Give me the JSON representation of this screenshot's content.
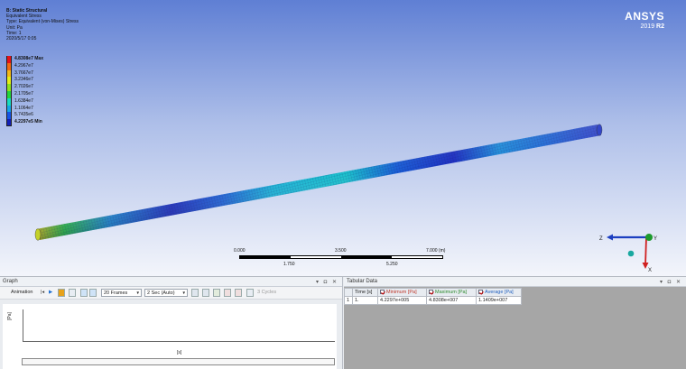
{
  "viewport": {
    "title": "B: Static Structural",
    "result_name": "Equivalent Stress",
    "type_line": "Type: Equivalent (von-Mises) Stress",
    "unit_line": "Unit: Pa",
    "time_line": "Time: 1",
    "date_line": "2020/5/17 0:05"
  },
  "brand": {
    "name": "ANSYS",
    "version": "2019",
    "release": "R2"
  },
  "legend": [
    {
      "label": "4.8308e7 Max",
      "color": "#e8121a",
      "emphasis": true
    },
    {
      "label": "4.2967e7",
      "color": "#f26a12",
      "emphasis": false
    },
    {
      "label": "3.7667e7",
      "color": "#f3b816",
      "emphasis": false
    },
    {
      "label": "3.2346e7",
      "color": "#e6ee16",
      "emphasis": false
    },
    {
      "label": "2.7026e7",
      "color": "#8ee21c",
      "emphasis": false
    },
    {
      "label": "2.1705e7",
      "color": "#22d63c",
      "emphasis": false
    },
    {
      "label": "1.6384e7",
      "color": "#16dcc0",
      "emphasis": false
    },
    {
      "label": "1.1064e7",
      "color": "#16a6e8",
      "emphasis": false
    },
    {
      "label": "5.7435e6",
      "color": "#1654e6",
      "emphasis": false
    },
    {
      "label": "4.2297e5 Min",
      "color": "#1220b8",
      "emphasis": true
    }
  ],
  "scale_bar": {
    "top_labels": [
      "0.000",
      "3.500",
      "7.000 (m)"
    ],
    "bottom_labels": [
      "1.750",
      "5.250"
    ]
  },
  "triad": {
    "x": "X",
    "y": "Y",
    "z": "Z"
  },
  "graph": {
    "title": "Graph",
    "animation_label": "Animation",
    "frames": "20 Frames",
    "duration": "2 Sec (Auto)",
    "cycles": "3 Cycles",
    "y_label": "[Pa]",
    "x_label": "[s]"
  },
  "tabular": {
    "title": "Tabular Data",
    "headers": [
      "Time [s]",
      "Minimum [Pa]",
      "Maximum [Pa]",
      "Average [Pa]"
    ],
    "rows": [
      {
        "index": "1",
        "time": "1.",
        "min": "4.2297e+005",
        "max": "4.8308e+007",
        "avg": "1.1409e+007"
      }
    ]
  },
  "colors": {
    "viewport_top": "#5f7fd4",
    "pipe_dark": "#2228b8",
    "pipe_mid": "#1a8fd8",
    "axis_x": "#d02020",
    "axis_y": "#1c9a2c",
    "axis_z": "#1c3fc0"
  }
}
